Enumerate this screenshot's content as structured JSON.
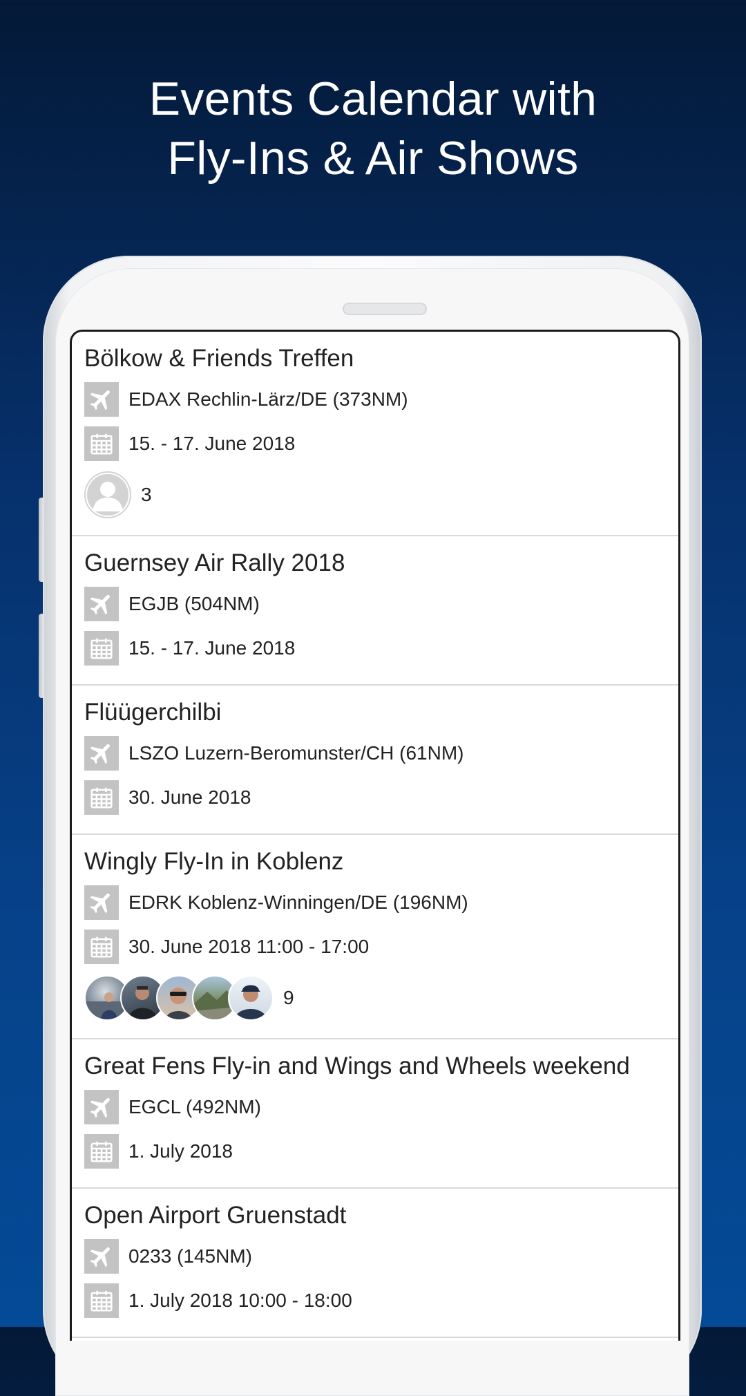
{
  "headline": {
    "line1": "Events Calendar with",
    "line2": "Fly-Ins & Air Shows"
  },
  "events": [
    {
      "title": "Bölkow & Friends Treffen",
      "airport": "EDAX Rechlin-Lärz/DE (373NM)",
      "date": "15. - 17. June 2018",
      "attendees": "3"
    },
    {
      "title": "Guernsey Air Rally 2018",
      "airport": "EGJB (504NM)",
      "date": "15. - 17. June 2018"
    },
    {
      "title": "Flüügerchilbi",
      "airport": "LSZO Luzern-Beromunster/CH (61NM)",
      "date": "30. June 2018"
    },
    {
      "title": "Wingly Fly-In in Koblenz",
      "airport": "EDRK Koblenz-Winningen/DE (196NM)",
      "date": "30. June 2018 11:00 - 17:00",
      "attendees": "9"
    },
    {
      "title": "Great Fens Fly-in and Wings and Wheels weekend",
      "airport": "EGCL (492NM)",
      "date": "1. July 2018"
    },
    {
      "title": "Open Airport Gruenstadt",
      "airport": "0233 (145NM)",
      "date": "1. July 2018 10:00 - 18:00"
    }
  ],
  "icons": {
    "airport": "airplane-icon",
    "date": "calendar-icon",
    "attendee": "person-avatar-icon"
  },
  "colors": {
    "background_top": "#041937",
    "background_bottom": "#044a96",
    "icon_tile": "#c3c3c3",
    "text": "#222222"
  }
}
